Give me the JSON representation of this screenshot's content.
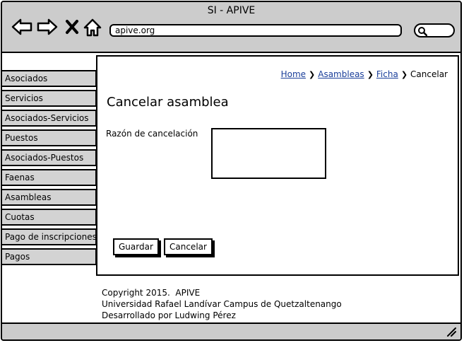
{
  "window": {
    "title": "SI - APIVE"
  },
  "browser": {
    "address": "apive.org"
  },
  "breadcrumb": {
    "home": "Home",
    "asambleas": "Asambleas",
    "ficha": "Ficha",
    "current": "Cancelar"
  },
  "sidebar": {
    "items": [
      {
        "label": "Asociados"
      },
      {
        "label": "Servicios"
      },
      {
        "label": "Asociados-Servicios"
      },
      {
        "label": "Puestos"
      },
      {
        "label": "Asociados-Puestos"
      },
      {
        "label": "Faenas"
      },
      {
        "label": "Asambleas"
      },
      {
        "label": "Cuotas"
      },
      {
        "label": "Pago de inscripciones"
      },
      {
        "label": "Pagos"
      }
    ]
  },
  "main": {
    "title": "Cancelar asamblea",
    "reason_label": "Razón de cancelación",
    "reason_value": "",
    "save_label": "Guardar",
    "cancel_label": "Cancelar"
  },
  "footer": {
    "line1": "Copyright 2015.  APIVE",
    "line2": "Universidad Rafael Landívar Campus de Quetzaltenango",
    "line3": "Desarrollado por Ludwing Pérez"
  },
  "icons": {
    "back": "back-arrow-icon",
    "forward": "forward-arrow-icon",
    "stop": "close-icon",
    "home": "home-icon",
    "search": "search-icon",
    "resize": "resize-grip-icon"
  }
}
